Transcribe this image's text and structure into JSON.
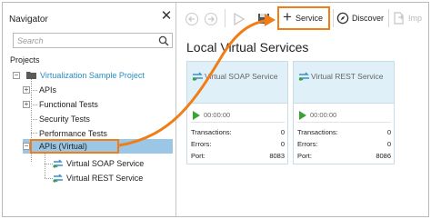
{
  "navigator": {
    "title": "Navigator",
    "search_placeholder": "Search",
    "projects_label": "Projects",
    "tree": {
      "project": "Virtualization Sample Project",
      "apis": "APIs",
      "functional_tests": "Functional Tests",
      "security_tests": "Security Tests",
      "performance_tests": "Performance Tests",
      "apis_virtual": "APIs (Virtual)",
      "virtual_soap": "Virtual SOAP Service",
      "virtual_rest": "Virtual REST Service"
    }
  },
  "toolbar": {
    "service_label": "Service",
    "discover_label": "Discover",
    "import_label": "Imp"
  },
  "content": {
    "title": "Local Virtual Services",
    "cards": [
      {
        "name": "Virtual SOAP Service",
        "time": "00:00:00",
        "transactions_label": "Transactions:",
        "transactions": "0",
        "errors_label": "Errors:",
        "errors": "0",
        "port_label": "Port:",
        "port": "8083"
      },
      {
        "name": "Virtual REST Service",
        "time": "00:00:00",
        "transactions_label": "Transactions:",
        "transactions": "0",
        "errors_label": "Errors:",
        "errors": "0",
        "port_label": "Port:",
        "port": "8086"
      }
    ]
  },
  "colors": {
    "highlight_orange": "#f07d16",
    "selection_blue": "#9cc6e6",
    "card_header": "#dff0f8",
    "project_link": "#2a8dc4",
    "play_green": "#39a339"
  }
}
